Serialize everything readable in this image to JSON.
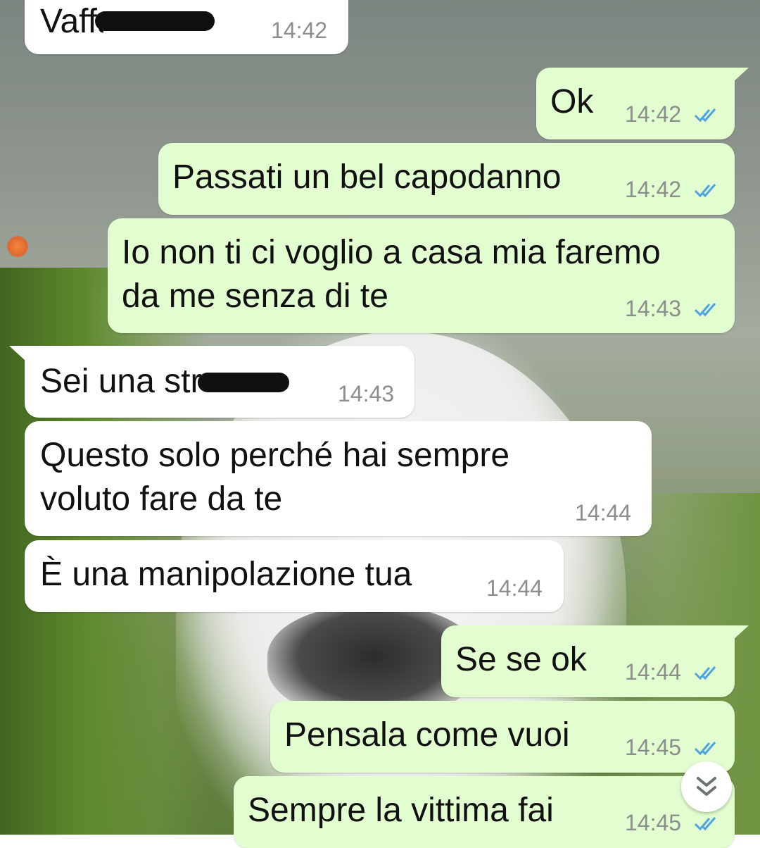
{
  "messages": [
    {
      "text": "Vaffanculo",
      "time": "14:42",
      "direction": "in",
      "redacted": true
    },
    {
      "text": "Ok",
      "time": "14:42",
      "direction": "out",
      "status": "read"
    },
    {
      "text": "Passati un bel capodanno",
      "time": "14:42",
      "direction": "out",
      "status": "read"
    },
    {
      "line1": "Io non ti ci voglio a casa mia faremo",
      "line2": "da me senza di te",
      "time": "14:43",
      "direction": "out",
      "status": "read"
    },
    {
      "text": "Sei una str",
      "time": "14:43",
      "direction": "in",
      "redacted": true
    },
    {
      "line1": "Questo solo perché hai sempre",
      "line2": "voluto fare da te",
      "time": "14:44",
      "direction": "in"
    },
    {
      "text": "È una manipolazione tua",
      "time": "14:44",
      "direction": "in"
    },
    {
      "text": "Se se ok",
      "time": "14:44",
      "direction": "out",
      "status": "read"
    },
    {
      "text": "Pensala come vuoi",
      "time": "14:45",
      "direction": "out",
      "status": "read"
    },
    {
      "text": "Sempre la vittima fai",
      "time": "14:45",
      "direction": "out",
      "status": "read"
    }
  ],
  "colors": {
    "incoming_bubble": "#ffffff",
    "outgoing_bubble": "#e2fdd0",
    "read_ticks": "#4fa3e0",
    "timestamp": "#8a8f8c"
  },
  "icons": {
    "read_receipt": "double-check-icon",
    "scroll_down": "double-chevron-down-icon"
  }
}
